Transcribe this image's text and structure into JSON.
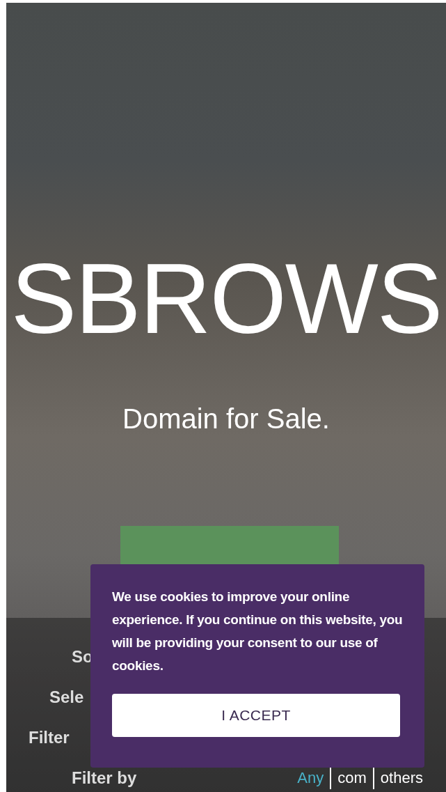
{
  "hero": {
    "title": "SBROWS",
    "subtitle": "Domain for Sale."
  },
  "filters": [
    {
      "label": "So"
    },
    {
      "label": "Sele"
    },
    {
      "label": "Filter"
    },
    {
      "label": "Filter by",
      "options": [
        {
          "label": "Any",
          "selected": true
        },
        {
          "label": "com",
          "selected": false
        },
        {
          "label": "others",
          "selected": false
        }
      ]
    }
  ],
  "cookie_banner": {
    "message": "We use cookies to improve your online experience. If you continue on this website, you will be providing your consent to our use of cookies.",
    "accept_button": "I ACCEPT"
  }
}
